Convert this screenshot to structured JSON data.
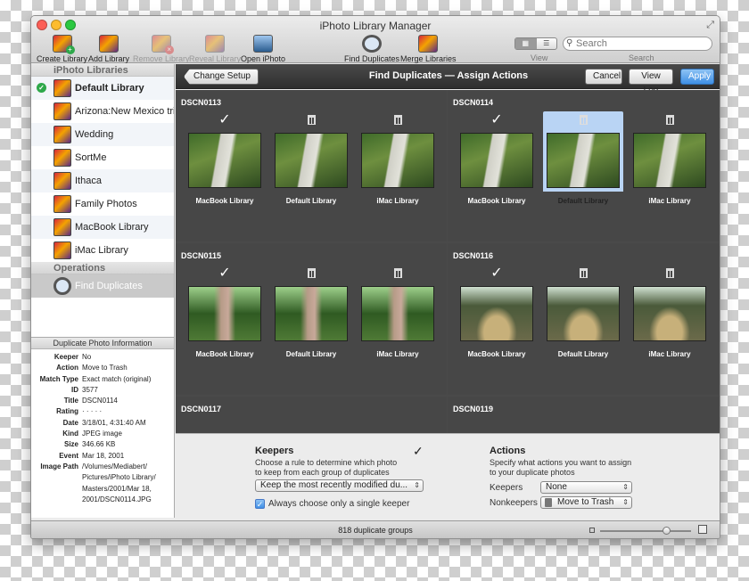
{
  "window": {
    "title": "iPhoto Library Manager"
  },
  "toolbar": {
    "items": [
      {
        "label": "Create Library",
        "icon": "create-library-icon",
        "enabled": true
      },
      {
        "label": "Add Library",
        "icon": "add-library-icon",
        "enabled": true
      },
      {
        "label": "Remove Library",
        "icon": "remove-library-icon",
        "enabled": false
      },
      {
        "label": "Reveal Library",
        "icon": "reveal-library-icon",
        "enabled": false
      },
      {
        "label": "Open iPhoto",
        "icon": "iphoto-icon",
        "enabled": true
      },
      {
        "label": "Find Duplicates",
        "icon": "find-duplicates-icon",
        "enabled": true
      },
      {
        "label": "Merge Libraries",
        "icon": "merge-libraries-icon",
        "enabled": true
      }
    ],
    "view_label": "View",
    "search_placeholder": "Search",
    "search_label": "Search"
  },
  "sidebar": {
    "libraries_header": "iPhoto Libraries",
    "libraries": [
      {
        "label": "Default Library",
        "default": true
      },
      {
        "label": "Arizona:New Mexico trip"
      },
      {
        "label": "Wedding"
      },
      {
        "label": "SortMe"
      },
      {
        "label": "Ithaca"
      },
      {
        "label": "Family Photos"
      },
      {
        "label": "MacBook Library"
      },
      {
        "label": "iMac Library"
      }
    ],
    "operations_header": "Operations",
    "operations": [
      {
        "label": "Find Duplicates",
        "selected": true
      }
    ]
  },
  "info": {
    "header": "Duplicate Photo Information",
    "rows": [
      {
        "k": "Keeper",
        "v": "No"
      },
      {
        "k": "Action",
        "v": "Move to Trash"
      },
      {
        "k": "Match Type",
        "v": "Exact match (original)"
      },
      {
        "k": "ID",
        "v": "3577"
      },
      {
        "k": "Title",
        "v": "DSCN0114"
      },
      {
        "k": "Rating",
        "v": "· · · · ·"
      },
      {
        "k": "Date",
        "v": "3/18/01, 4:31:40 AM"
      },
      {
        "k": "Kind",
        "v": "JPEG image"
      },
      {
        "k": "Size",
        "v": "346.66 KB"
      },
      {
        "k": "Event",
        "v": "Mar 18, 2001"
      },
      {
        "k": "Image Path",
        "v": "/Volumes/Mediabert/ Pictures/iPhoto Library/ Masters/2001/Mar 18, 2001/DSCN0114.JPG"
      }
    ]
  },
  "main_toolbar": {
    "back_label": "Change Setup",
    "title": "Find Duplicates — Assign Actions",
    "cancel_label": "Cancel",
    "viewlog_label": "View Log",
    "apply_label": "Apply"
  },
  "groups": [
    {
      "name": "DSCN0113",
      "scene": "path",
      "photos": [
        {
          "library": "MacBook Library",
          "keeper": true
        },
        {
          "library": "Default Library",
          "keeper": false
        },
        {
          "library": "iMac Library",
          "keeper": false
        }
      ]
    },
    {
      "name": "DSCN0114",
      "scene": "path",
      "photos": [
        {
          "library": "MacBook Library",
          "keeper": true
        },
        {
          "library": "Default Library",
          "keeper": false,
          "selected": true
        },
        {
          "library": "iMac Library",
          "keeper": false
        }
      ]
    },
    {
      "name": "DSCN0115",
      "scene": "trees",
      "photos": [
        {
          "library": "MacBook Library",
          "keeper": true
        },
        {
          "library": "Default Library",
          "keeper": false
        },
        {
          "library": "iMac Library",
          "keeper": false
        }
      ]
    },
    {
      "name": "DSCN0116",
      "scene": "oaks",
      "photos": [
        {
          "library": "MacBook Library",
          "keeper": true
        },
        {
          "library": "Default Library",
          "keeper": false
        },
        {
          "library": "iMac Library",
          "keeper": false
        }
      ]
    },
    {
      "name": "DSCN0117",
      "scene": "",
      "photos": []
    },
    {
      "name": "DSCN0119",
      "scene": "",
      "photos": []
    }
  ],
  "keepers": {
    "title": "Keepers",
    "desc": "Choose a rule to determine which photo to keep from each group of duplicates",
    "rule": "Keep the most recently modified du...",
    "single_label": "Always choose only a single keeper",
    "single_checked": true
  },
  "actions": {
    "title": "Actions",
    "desc": "Specify what actions you want to assign to your duplicate photos",
    "keepers_label": "Keepers",
    "keepers_value": "None",
    "nonkeepers_label": "Nonkeepers",
    "nonkeepers_value": "Move to Trash"
  },
  "status": {
    "text": "818 duplicate groups",
    "zoom": 0.75
  },
  "colors": {
    "accent": "#3f8fe5",
    "selection": "#b9d4f4",
    "grid_bg": "#474747"
  }
}
